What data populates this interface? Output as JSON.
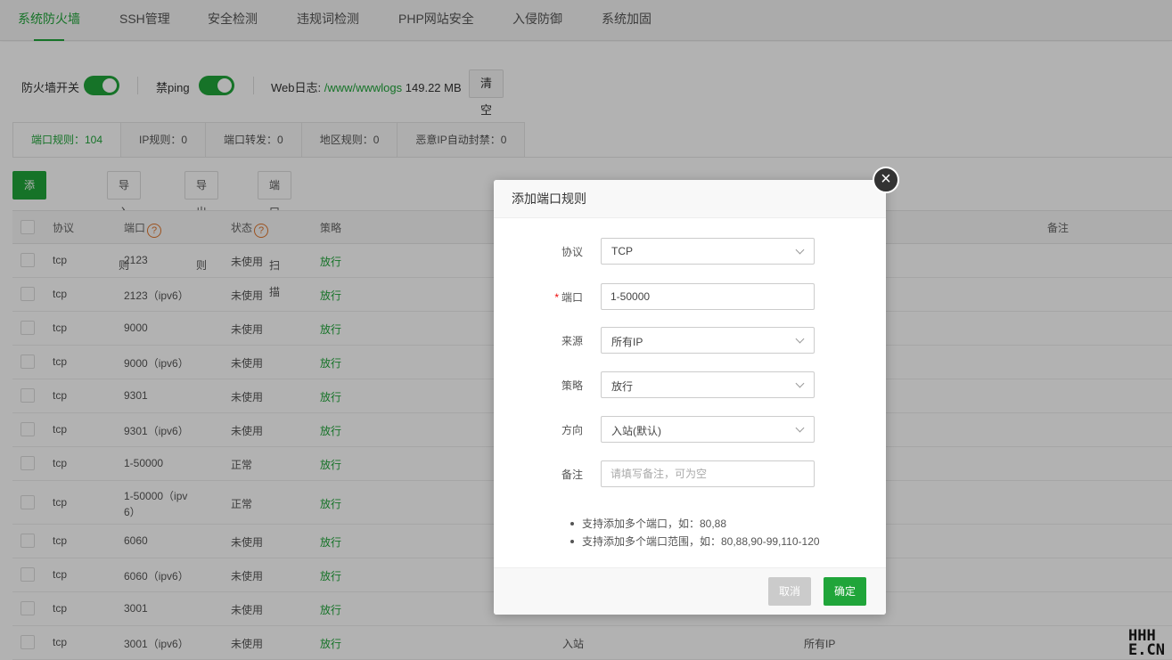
{
  "nav": {
    "tabs": [
      {
        "label": "系统防火墙",
        "active": true
      },
      {
        "label": "SSH管理"
      },
      {
        "label": "安全检测"
      },
      {
        "label": "违规词检测"
      },
      {
        "label": "PHP网站安全"
      },
      {
        "label": "入侵防御"
      },
      {
        "label": "系统加固"
      }
    ]
  },
  "switches": {
    "firewall_label": "防火墙开关",
    "ping_label": "禁ping",
    "weblog_label": "Web日志:",
    "weblog_path": "/www/wwwlogs",
    "weblog_size": "149.22 MB",
    "clear_button": "清空"
  },
  "subtabs": [
    "端口规则：104",
    "IP规则：0",
    "端口转发：0",
    "地区规则：0",
    "恶意IP自动封禁：0"
  ],
  "actions": {
    "add": "添加端口规则",
    "import": "导入规则",
    "export": "导出规则",
    "scan": "端口防扫描"
  },
  "table": {
    "headers": {
      "protocol": "协议",
      "port": "端口",
      "status": "状态",
      "policy": "策略",
      "remark": "备注"
    },
    "rows": [
      {
        "protocol": "tcp",
        "port": "2123",
        "status": "未使用",
        "policy": "放行"
      },
      {
        "protocol": "tcp",
        "port": "2123（ipv6）",
        "status": "未使用",
        "policy": "放行"
      },
      {
        "protocol": "tcp",
        "port": "9000",
        "status": "未使用",
        "policy": "放行"
      },
      {
        "protocol": "tcp",
        "port": "9000（ipv6）",
        "status": "未使用",
        "policy": "放行"
      },
      {
        "protocol": "tcp",
        "port": "9301",
        "status": "未使用",
        "policy": "放行"
      },
      {
        "protocol": "tcp",
        "port": "9301（ipv6）",
        "status": "未使用",
        "policy": "放行"
      },
      {
        "protocol": "tcp",
        "port": "1-50000",
        "status": "正常",
        "policy": "放行"
      },
      {
        "protocol": "tcp",
        "port_line1": "1-50000（ipv",
        "port_line2": "6）",
        "status": "正常",
        "policy": "放行"
      },
      {
        "protocol": "tcp",
        "port": "6060",
        "status": "未使用",
        "policy": "放行"
      },
      {
        "protocol": "tcp",
        "port": "6060（ipv6）",
        "status": "未使用",
        "policy": "放行"
      },
      {
        "protocol": "tcp",
        "port": "3001",
        "status": "未使用",
        "policy": "放行"
      },
      {
        "protocol": "tcp",
        "port": "3001（ipv6）",
        "status": "未使用",
        "policy": "放行",
        "direction": "入站",
        "source": "所有IP"
      }
    ]
  },
  "modal": {
    "title": "添加端口规则",
    "fields": {
      "protocol_label": "协议",
      "protocol_value": "TCP",
      "port_required": "*",
      "port_label": "端口",
      "port_value": "1-50000",
      "source_label": "来源",
      "source_value": "所有IP",
      "policy_label": "策略",
      "policy_value": "放行",
      "direction_label": "方向",
      "direction_value": "入站(默认)",
      "remark_label": "备注",
      "remark_placeholder": "请填写备注，可为空"
    },
    "tips": [
      "支持添加多个端口，如：80,88",
      "支持添加多个端口范围，如：80,88,90-99,110-120"
    ],
    "cancel": "取消",
    "confirm": "确定",
    "close_symbol": "×"
  },
  "watermark": {
    "line1": "HHH",
    "line2": "E.CN"
  },
  "colors": {
    "accent": "#20a53a",
    "warning": "#e0762d",
    "required": "#ef0808"
  }
}
